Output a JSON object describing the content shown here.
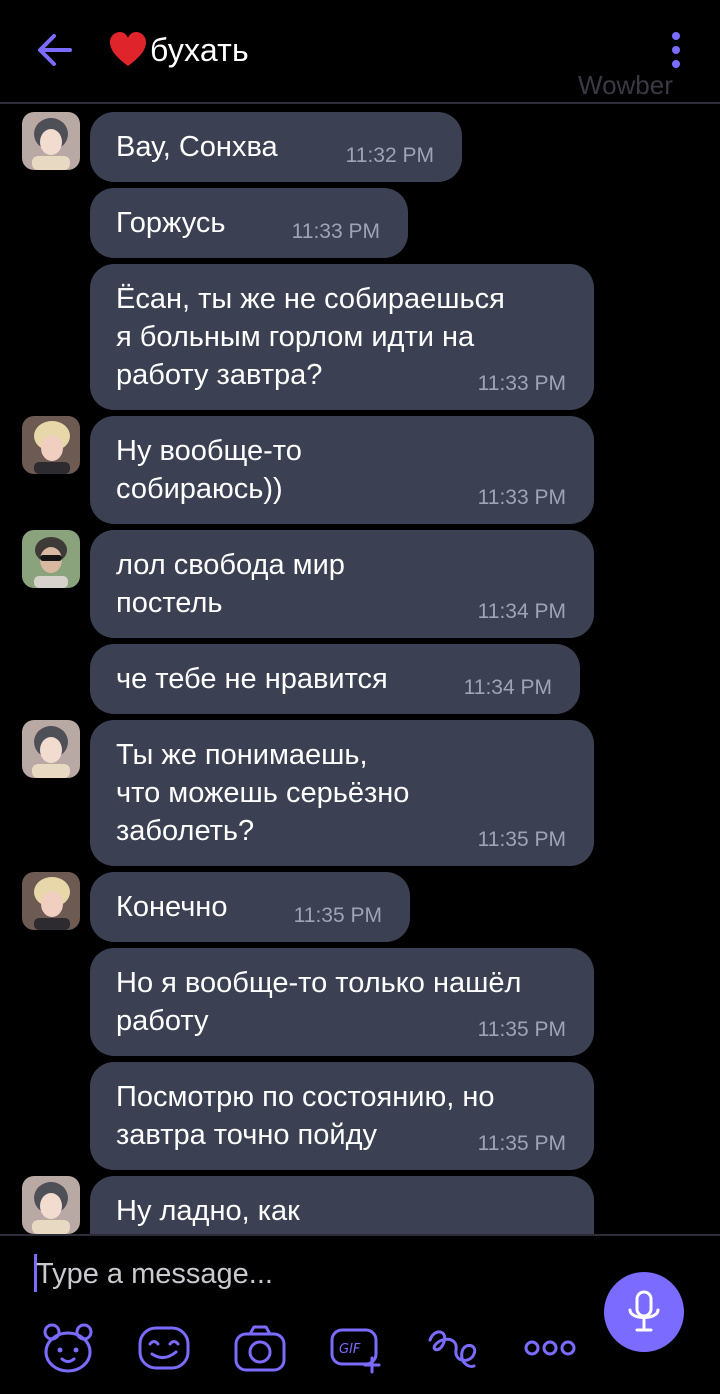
{
  "header": {
    "title": "бухать",
    "watermark": "Wowber"
  },
  "messages": [
    {
      "text": "Вау, Сонхва",
      "time": "11:32 PM"
    },
    {
      "text": "Горжусь",
      "time": "11:33 PM"
    },
    {
      "text": "Ёсан, ты же не собираешься\nя больным горлом идти на\nработу завтра?",
      "time": "11:33 PM"
    },
    {
      "text": "Ну вообще-то\nсобираюсь))",
      "time": "11:33 PM"
    },
    {
      "text": "лол свобода мир\nпостель",
      "time": "11:34 PM"
    },
    {
      "text": "че тебе не нравится",
      "time": "11:34 PM"
    },
    {
      "text": "Ты же понимаешь,\nчто можешь серьёзно\nзаболеть?",
      "time": "11:35 PM"
    },
    {
      "text": "Конечно",
      "time": "11:35 PM"
    },
    {
      "text": "Но я вообще-то только нашёл\nработу",
      "time": "11:35 PM"
    },
    {
      "text": "Посмотрю по состоянию, но\nзавтра точно пойду",
      "time": "11:35 PM"
    },
    {
      "text": "Ну ладно, как",
      "time": ""
    }
  ],
  "composer": {
    "placeholder": "Type a message..."
  },
  "icons": {
    "back": "back-arrow-icon",
    "menu": "more-vertical-icon",
    "mic": "microphone-icon",
    "toolbar": [
      "sticker-bear-icon",
      "emoji-face-icon",
      "camera-icon",
      "gif-icon",
      "doodle-icon",
      "more-horizontal-icon"
    ]
  },
  "colors": {
    "accent": "#7b6cff",
    "bubble": "#3b4052",
    "background": "#000000",
    "timestamp": "#9ea3b6",
    "heart": "#e0242c"
  }
}
